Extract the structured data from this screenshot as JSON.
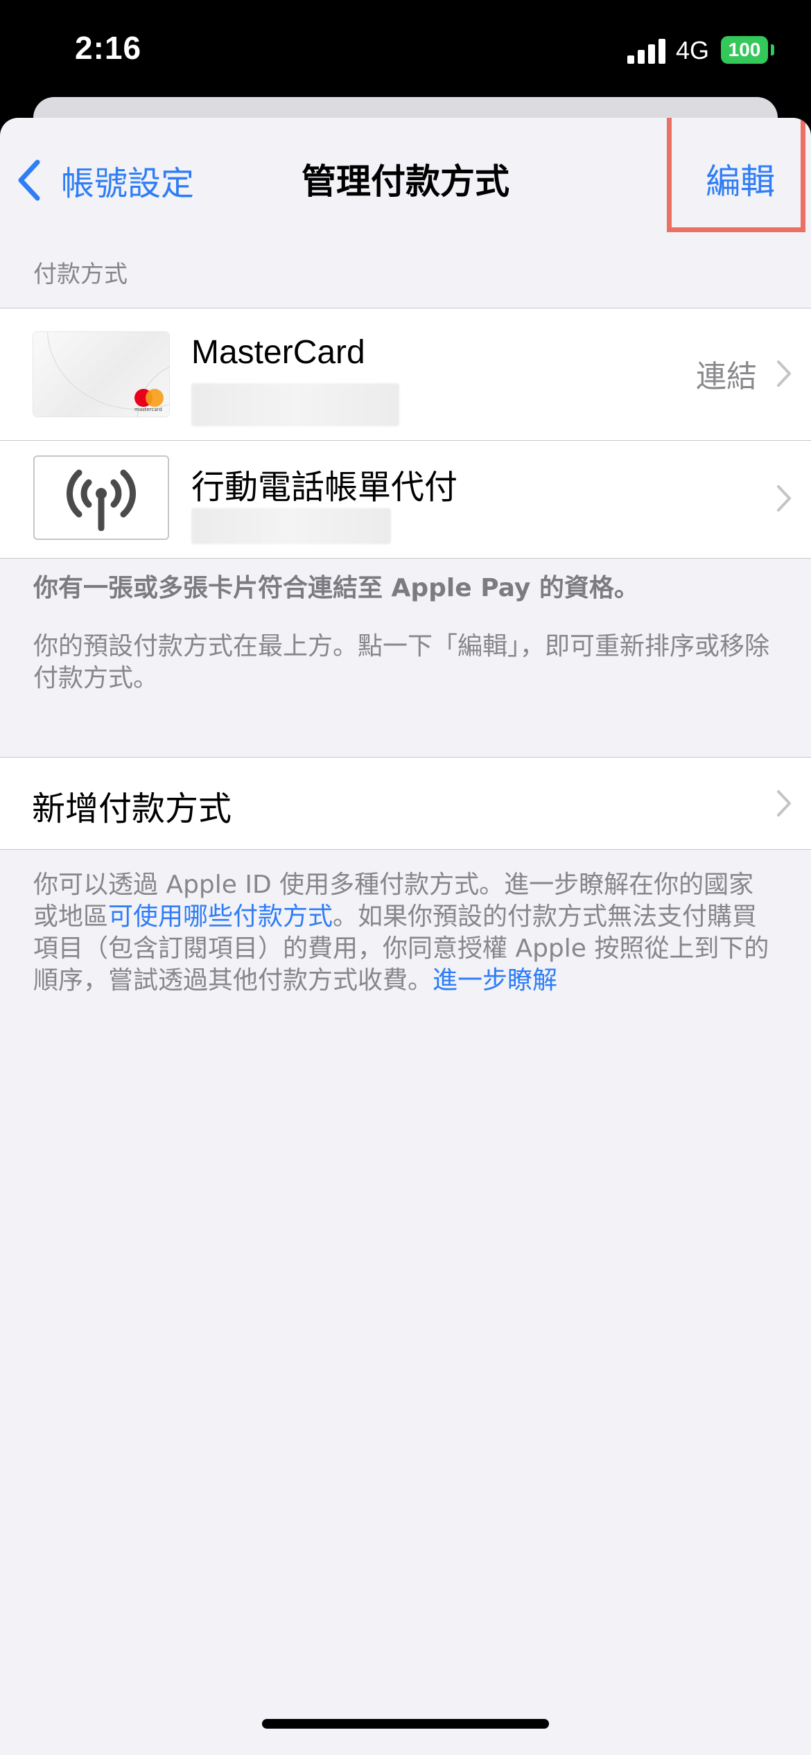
{
  "status_bar": {
    "time": "2:16",
    "network": "4G",
    "battery": "100"
  },
  "nav": {
    "back_label": "帳號設定",
    "title": "管理付款方式",
    "edit_label": "編輯"
  },
  "section_header": "付款方式",
  "payment_methods": [
    {
      "name": "MasterCard",
      "detail": "連結",
      "card_brand": "mastercard"
    },
    {
      "name": "行動電話帳單代付",
      "detail": ""
    }
  ],
  "notes": {
    "eligible": "你有一張或多張卡片符合連結至 Apple Pay 的資格。",
    "order": "你的預設付款方式在最上方。點一下「編輯」，即可重新排序或移除付款方式。"
  },
  "add_method_label": "新增付款方式",
  "info": {
    "part1": "你可以透過 Apple ID 使用多種付款方式。進一步瞭解在你的國家或地區",
    "link1": "可使用哪些付款方式",
    "part2": "。如果你預設的付款方式無法支付購買項目（包含訂閱項目）的費用，你同意授權 Apple 按照從上到下的順序，嘗試透過其他付款方式收費。",
    "link2": "進一步瞭解"
  },
  "colors": {
    "accent": "#2f7df6",
    "highlight": "#eb6f62",
    "background": "#f2f2f7",
    "battery": "#34c759"
  },
  "icons": [
    "chevron-left-icon",
    "chevron-right-icon",
    "cellular-antenna-icon",
    "mastercard-logo-icon"
  ]
}
